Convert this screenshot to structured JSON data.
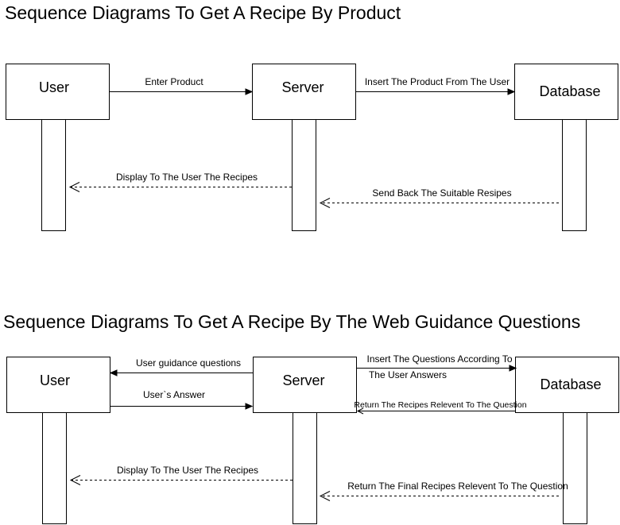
{
  "diagram1": {
    "title": "Sequence Diagrams To Get A Recipe By Product",
    "participants": {
      "user": "User",
      "server": "Server",
      "database": "Database"
    },
    "messages": {
      "m1": "Enter Product",
      "m2": "Insert The Product From The User",
      "m3": "Send Back The Suitable Resipes",
      "m4": "Display To The User The Recipes"
    }
  },
  "diagram2": {
    "title": "Sequence Diagrams To Get A Recipe By The Web  Guidance Questions",
    "participants": {
      "user": "User",
      "server": "Server",
      "database": "Database"
    },
    "messages": {
      "m1": "User guidance questions",
      "m2": "User`s Answer",
      "m3_line1": "Insert The Questions According To",
      "m3_line2": "The User Answers",
      "m4": "Return The Recipes Relevent To The Question",
      "m5": "Return The Final Recipes Relevent To The Question",
      "m6": "Display To The User The Recipes"
    }
  }
}
